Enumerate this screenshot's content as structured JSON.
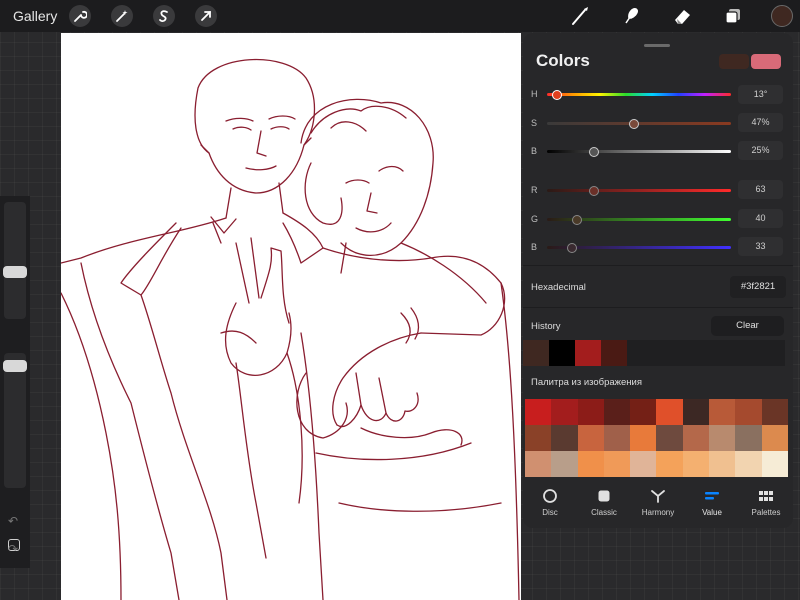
{
  "topbar": {
    "gallery_label": "Gallery",
    "left_tools": [
      "wrench-icon",
      "magic-wand-icon",
      "selection-icon",
      "transform-arrow-icon"
    ],
    "right_tools": [
      "brush-icon",
      "smudge-icon",
      "eraser-icon",
      "layers-icon"
    ],
    "current_color": "#3f2821"
  },
  "sidebar": {
    "brush_size_level": 0.2,
    "opacity_level": 0.15
  },
  "colors": {
    "title": "Colors",
    "secondary_color": "#3f2821",
    "primary_color": "#d86a78",
    "hsb": [
      {
        "label": "H",
        "value": "13°",
        "level": 0.05
      },
      {
        "label": "S",
        "value": "47%",
        "level": 0.47
      },
      {
        "label": "B",
        "value": "25%",
        "level": 0.25
      }
    ],
    "rgb": [
      {
        "label": "R",
        "value": "63",
        "level": 0.25
      },
      {
        "label": "G",
        "value": "40",
        "level": 0.16
      },
      {
        "label": "B",
        "value": "33",
        "level": 0.13
      }
    ],
    "hex_label": "Hexadecimal",
    "hex_value": "#3f2821",
    "history_label": "History",
    "clear_label": "Clear",
    "history": [
      "#3f2821",
      "#000000",
      "#a31d1d",
      "#4a1a14"
    ],
    "palette_label": "Палитра из изображения",
    "palette": [
      "#c81e1e",
      "#a31d1d",
      "#8c1c18",
      "#5a1f1a",
      "#742016",
      "#e0502a",
      "#3c2824",
      "#b85a38",
      "#a54a2e",
      "#6a3526",
      "#8a4128",
      "#5a3a30",
      "#c8643e",
      "#a0604a",
      "#e87a3a",
      "#6e4a3e",
      "#b4684a",
      "#b88a6e",
      "#8a7060",
      "#dc8a4e",
      "#d09070",
      "#b89e8a",
      "#f0904a",
      "#f09a58",
      "#e0b498",
      "#f4a25a",
      "#f4b070",
      "#f0c090",
      "#f2d4b0",
      "#f6ecd6"
    ],
    "tabs": [
      {
        "label": "Disc",
        "icon": "disc-icon",
        "active": false
      },
      {
        "label": "Classic",
        "icon": "classic-icon",
        "active": false
      },
      {
        "label": "Harmony",
        "icon": "harmony-icon",
        "active": false
      },
      {
        "label": "Value",
        "icon": "value-icon",
        "active": true
      },
      {
        "label": "Palettes",
        "icon": "palettes-icon",
        "active": false
      }
    ],
    "accent": "#0a84ff"
  }
}
